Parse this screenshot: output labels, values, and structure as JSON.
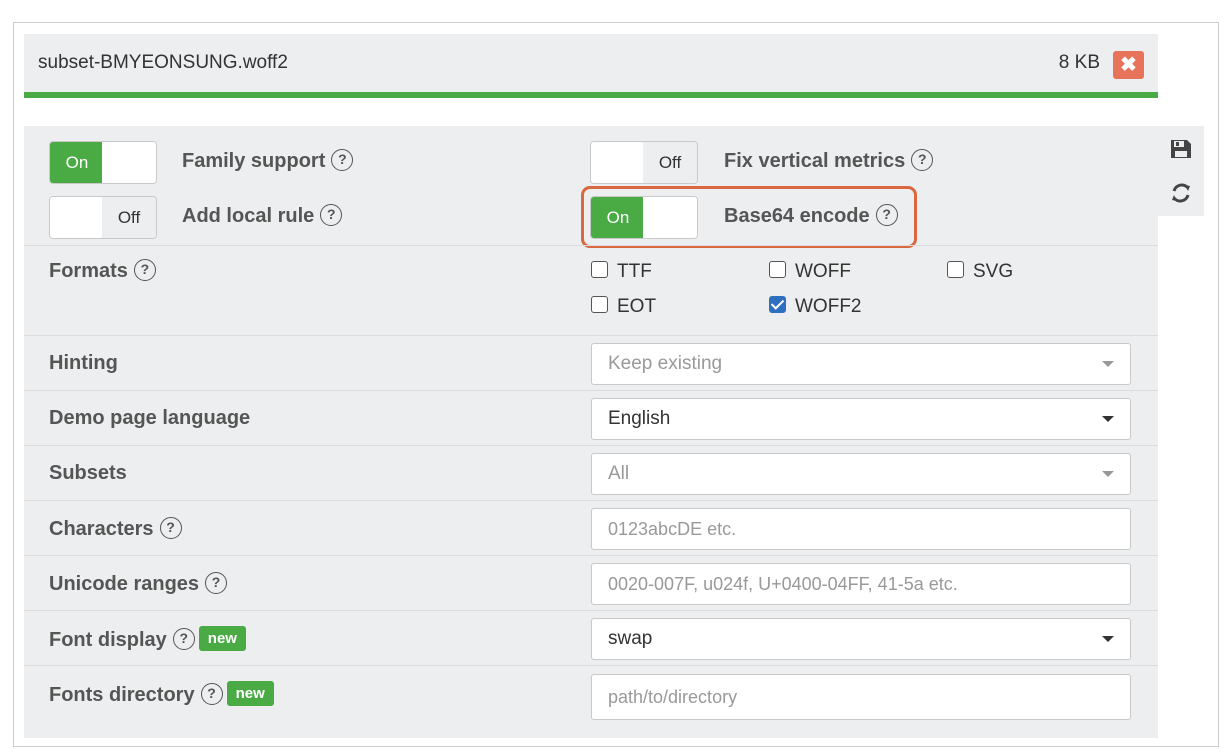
{
  "file": {
    "name": "subset-BMYEONSUNG.woff2",
    "size": "8 KB",
    "close_icon": "✖"
  },
  "options": {
    "family_support": {
      "label": "Family support",
      "state": "On"
    },
    "add_local_rule": {
      "label": "Add local rule",
      "state": "Off"
    },
    "fix_vertical_metrics": {
      "label": "Fix vertical metrics",
      "state": "Off"
    },
    "base64_encode": {
      "label": "Base64 encode",
      "state": "On"
    }
  },
  "toggle_text": {
    "on": "On",
    "off": "Off"
  },
  "help_glyph": "?",
  "new_badge": "new",
  "formats": {
    "label": "Formats",
    "items": [
      {
        "name": "TTF",
        "checked": false
      },
      {
        "name": "WOFF",
        "checked": false
      },
      {
        "name": "SVG",
        "checked": false
      },
      {
        "name": "EOT",
        "checked": false
      },
      {
        "name": "WOFF2",
        "checked": true
      }
    ]
  },
  "hinting": {
    "label": "Hinting",
    "value": "Keep existing"
  },
  "demo_language": {
    "label": "Demo page language",
    "value": "English"
  },
  "subsets": {
    "label": "Subsets",
    "value": "All"
  },
  "characters": {
    "label": "Characters",
    "placeholder": "0123abcDE etc."
  },
  "unicode_ranges": {
    "label": "Unicode ranges",
    "placeholder": "0020-007F, u024f, U+0400-04FF, 41-5a etc."
  },
  "font_display": {
    "label": "Font display",
    "value": "swap"
  },
  "fonts_directory": {
    "label": "Fonts directory",
    "placeholder": "path/to/directory"
  },
  "icons": {
    "save": "save-icon",
    "reload": "reload-icon",
    "close": "close-icon",
    "help": "help-icon"
  },
  "colors": {
    "accent_green": "#4aab45",
    "close_red": "#e8735b",
    "highlight_orange": "#d9673f",
    "checkbox_blue": "#2f6fc0"
  }
}
